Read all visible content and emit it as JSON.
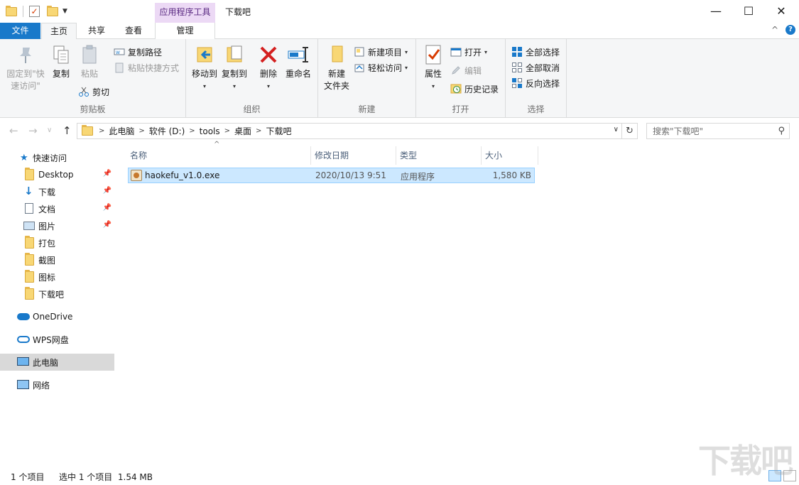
{
  "quick_access_toolbar": {
    "icons": [
      "folder-icon",
      "properties-check-icon",
      "new-folder-icon",
      "customize-dropdown-icon"
    ]
  },
  "titlebar": {
    "context_tab_header": "应用程序工具",
    "title": "下载吧",
    "minimize_glyph": "—",
    "maximize_glyph": "☐",
    "close_glyph": "✕"
  },
  "tabs": {
    "file": "文件",
    "home": "主页",
    "share": "共享",
    "view": "查看",
    "manage": "管理",
    "collapse_glyph": "^",
    "help_glyph": "?"
  },
  "ribbon": {
    "clipboard": {
      "label": "剪贴板",
      "pin_quick_access": "固定到\"快速访问\"",
      "copy": "复制",
      "paste": "粘贴",
      "copy_path": "复制路径",
      "paste_shortcut": "粘贴快捷方式",
      "cut": "剪切"
    },
    "organize": {
      "label": "组织",
      "move_to": "移动到",
      "copy_to": "复制到",
      "delete": "删除",
      "rename": "重命名"
    },
    "new": {
      "label": "新建",
      "new_folder": "新建\n文件夹",
      "new_item": "新建项目",
      "easy_access": "轻松访问"
    },
    "open": {
      "label": "打开",
      "properties": "属性",
      "open": "打开",
      "edit": "编辑",
      "history": "历史记录"
    },
    "select": {
      "label": "选择",
      "select_all": "全部选择",
      "select_none": "全部取消",
      "invert_selection": "反向选择"
    }
  },
  "address": {
    "back_glyph": "←",
    "forward_glyph": "→",
    "recent_glyph": "∨",
    "up_glyph": "↑",
    "breadcrumbs": [
      "此电脑",
      "软件 (D:)",
      "tools",
      "桌面",
      "下载吧"
    ],
    "separator": ">",
    "refresh_glyph": "↻",
    "search_placeholder": "搜索\"下载吧\""
  },
  "nav": {
    "quick_access": "快速访问",
    "items": [
      {
        "label": "Desktop",
        "icon": "folder-icon",
        "pinned": true
      },
      {
        "label": "下载",
        "icon": "download-arrow-icon",
        "pinned": true
      },
      {
        "label": "文档",
        "icon": "document-icon",
        "pinned": true
      },
      {
        "label": "图片",
        "icon": "pictures-icon",
        "pinned": true
      },
      {
        "label": "打包",
        "icon": "folder-icon",
        "pinned": false
      },
      {
        "label": "截图",
        "icon": "folder-icon",
        "pinned": false
      },
      {
        "label": "图标",
        "icon": "folder-icon",
        "pinned": false
      },
      {
        "label": "下载吧",
        "icon": "folder-icon",
        "pinned": false
      }
    ],
    "onedrive": "OneDrive",
    "wps": "WPS网盘",
    "this_pc": "此电脑",
    "network": "网络"
  },
  "file_list": {
    "columns": [
      "名称",
      "修改日期",
      "类型",
      "大小"
    ],
    "sort_caret": "^",
    "rows": [
      {
        "name": "haokefu_v1.0.exe",
        "modified": "2020/10/13 9:51",
        "type": "应用程序",
        "size": "1,580 KB",
        "selected": true
      }
    ]
  },
  "status": {
    "count": "1 个项目",
    "selected": "选中 1 个项目  1.54 MB"
  },
  "watermark": "下载吧",
  "colors": {
    "accent": "#1979ca",
    "selection": "#cce8ff",
    "context_tab": "#ecd9f5"
  }
}
